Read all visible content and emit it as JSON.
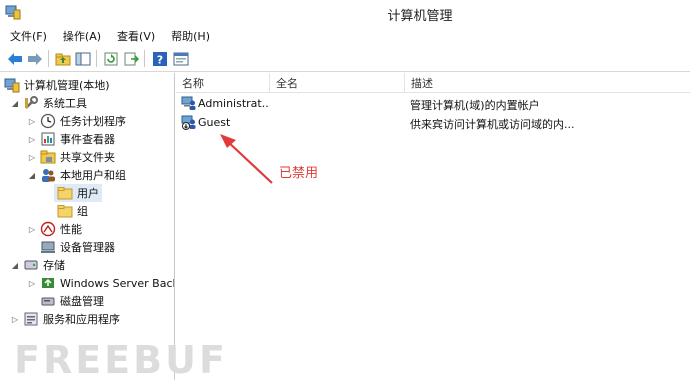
{
  "window": {
    "title": "计算机管理"
  },
  "menu": [
    {
      "label": "文件(F)"
    },
    {
      "label": "操作(A)"
    },
    {
      "label": "查看(V)"
    },
    {
      "label": "帮助(H)"
    }
  ],
  "toolbar": {
    "buttons": [
      "back-icon",
      "forward-icon",
      "up-folder-icon",
      "show-hide-tree-icon",
      "refresh-icon",
      "export-list-icon",
      "help-icon",
      "properties-icon"
    ]
  },
  "tree": {
    "root": "计算机管理(本地)",
    "system_tools": "系统工具",
    "task_scheduler": "任务计划程序",
    "event_viewer": "事件查看器",
    "shared_folders": "共享文件夹",
    "local_users": "本地用户和组",
    "users": "用户",
    "groups": "组",
    "performance": "性能",
    "device_manager": "设备管理器",
    "storage": "存储",
    "windows_backup": "Windows Server Back",
    "disk_management": "磁盘管理",
    "services_apps": "服务和应用程序"
  },
  "list": {
    "columns": [
      "名称",
      "全名",
      "描述"
    ],
    "rows": [
      {
        "name": "Administrat...",
        "fullname": "",
        "description": "管理计算机(域)的内置帐户",
        "icon": "user-icon",
        "disabled": false
      },
      {
        "name": "Guest",
        "fullname": "",
        "description": "供来宾访问计算机或访问域的内...",
        "icon": "disabled-user-icon",
        "disabled": true
      }
    ]
  },
  "annotation": {
    "text": "已禁用",
    "color": "#e23a3a"
  },
  "watermark": "FREEBUF",
  "colors": {
    "selection": "#dfeaf7",
    "annotation": "#e23a3a"
  }
}
